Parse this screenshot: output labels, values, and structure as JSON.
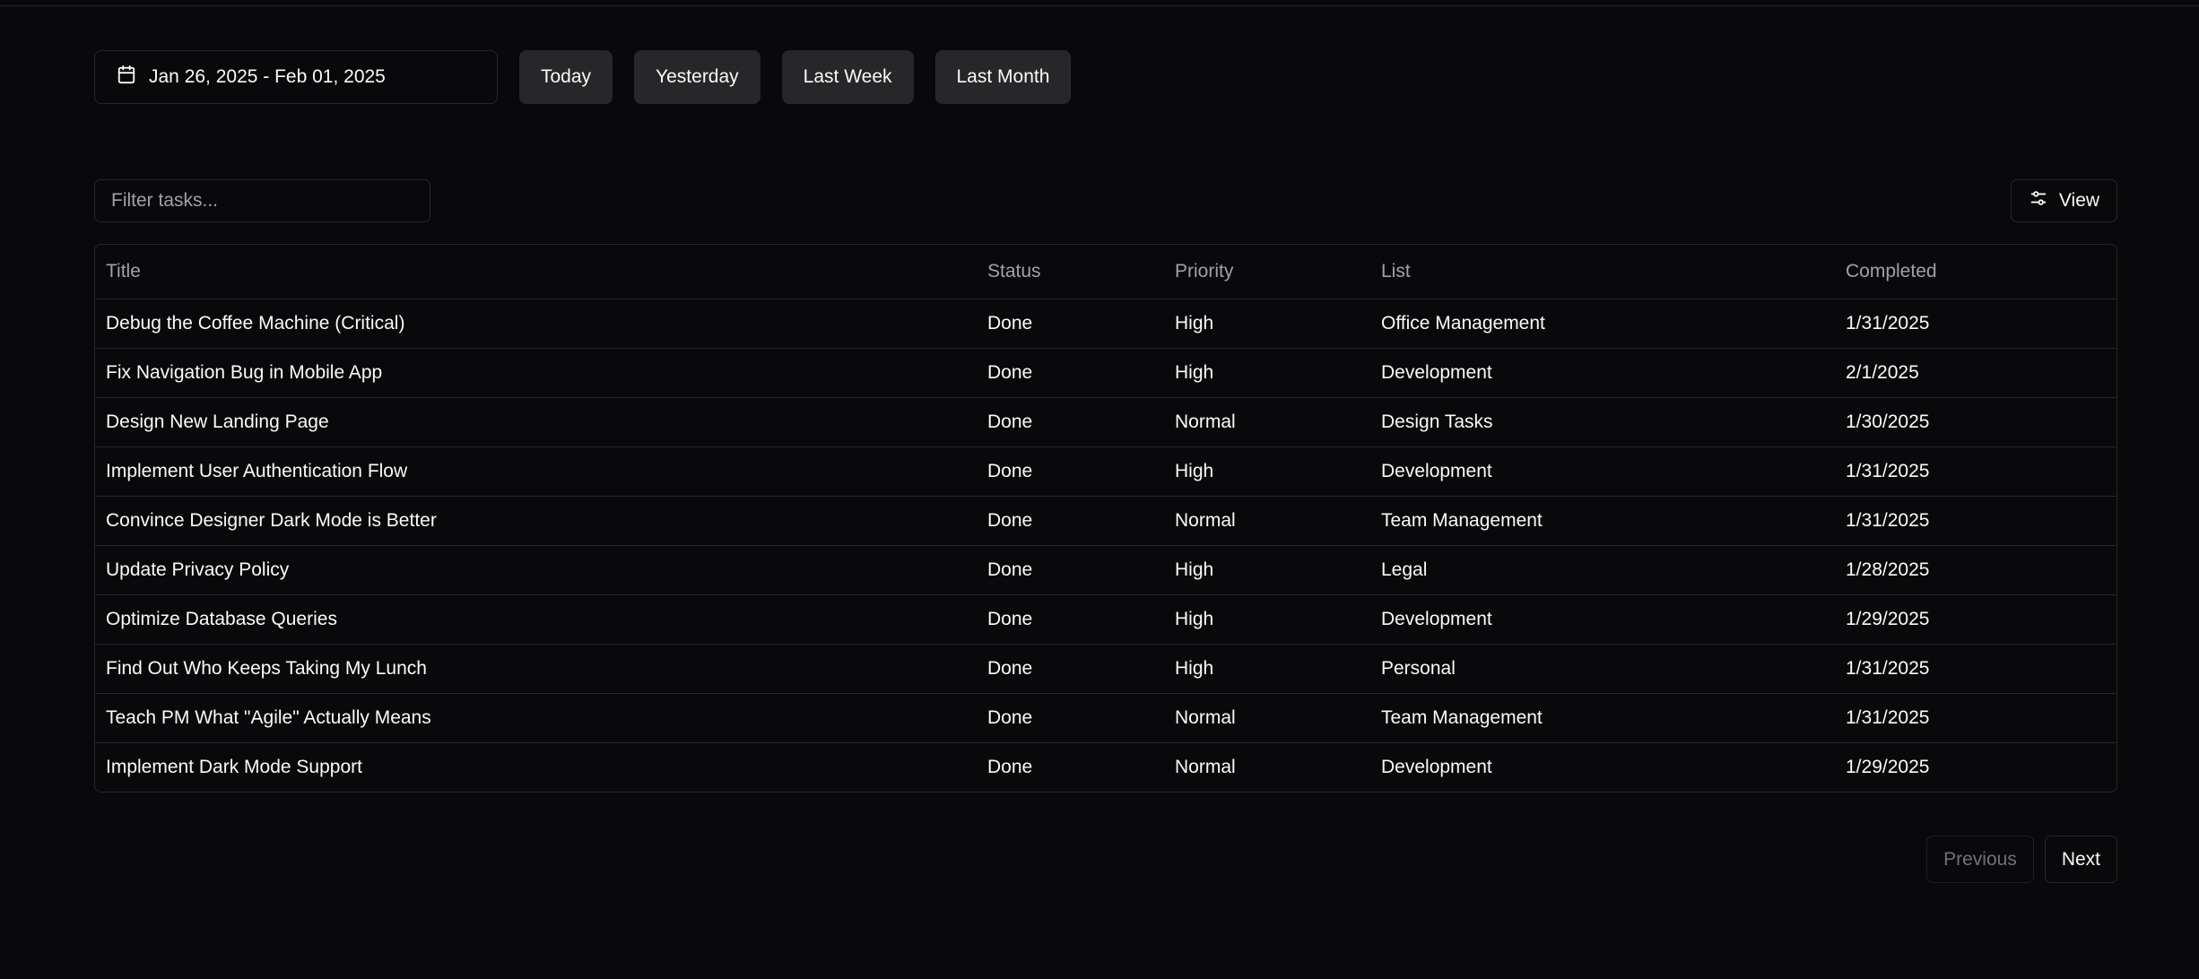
{
  "date_range": {
    "label": "Jan 26, 2025 - Feb 01, 2025",
    "icon": "calendar-icon"
  },
  "presets": [
    {
      "label": "Today"
    },
    {
      "label": "Yesterday"
    },
    {
      "label": "Last Week"
    },
    {
      "label": "Last Month"
    }
  ],
  "filter": {
    "placeholder": "Filter tasks...",
    "value": ""
  },
  "view_button": {
    "label": "View",
    "icon": "sliders-icon"
  },
  "table": {
    "columns": [
      "Title",
      "Status",
      "Priority",
      "List",
      "Completed"
    ],
    "rows": [
      [
        "Debug the Coffee Machine (Critical)",
        "Done",
        "High",
        "Office Management",
        "1/31/2025"
      ],
      [
        "Fix Navigation Bug in Mobile App",
        "Done",
        "High",
        "Development",
        "2/1/2025"
      ],
      [
        "Design New Landing Page",
        "Done",
        "Normal",
        "Design Tasks",
        "1/30/2025"
      ],
      [
        "Implement User Authentication Flow",
        "Done",
        "High",
        "Development",
        "1/31/2025"
      ],
      [
        "Convince Designer Dark Mode is Better",
        "Done",
        "Normal",
        "Team Management",
        "1/31/2025"
      ],
      [
        "Update Privacy Policy",
        "Done",
        "High",
        "Legal",
        "1/28/2025"
      ],
      [
        "Optimize Database Queries",
        "Done",
        "High",
        "Development",
        "1/29/2025"
      ],
      [
        "Find Out Who Keeps Taking My Lunch",
        "Done",
        "High",
        "Personal",
        "1/31/2025"
      ],
      [
        "Teach PM What \"Agile\" Actually Means",
        "Done",
        "Normal",
        "Team Management",
        "1/31/2025"
      ],
      [
        "Implement Dark Mode Support",
        "Done",
        "Normal",
        "Development",
        "1/29/2025"
      ]
    ]
  },
  "pagination": {
    "previous_label": "Previous",
    "next_label": "Next"
  },
  "colors": {
    "background": "#09090b",
    "border": "#27272a",
    "button_bg": "#27272a",
    "text": "#fafafa",
    "muted_text": "#a1a1aa"
  }
}
